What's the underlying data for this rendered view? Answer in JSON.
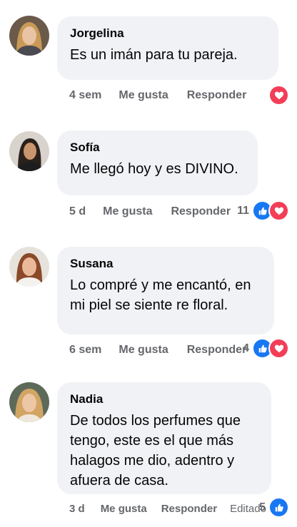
{
  "comments": [
    {
      "name": "Jorgelina",
      "text": "Es un imán para tu pareja.",
      "time": "4 sem",
      "like_label": "Me gusta",
      "reply_label": "Responder",
      "reaction_count": "",
      "reactions": [
        "heart-icon"
      ]
    },
    {
      "name": "Sofía",
      "text": "Me llegó hoy y es DIVINO.",
      "time": "5 d",
      "like_label": "Me gusta",
      "reply_label": "Responder",
      "reaction_count": "11",
      "reactions": [
        "like-icon",
        "heart-icon"
      ]
    },
    {
      "name": "Susana",
      "text": "Lo compré y me encantó, en mi piel se siente re floral.",
      "time": "6 sem",
      "like_label": "Me gusta",
      "reply_label": "Responder",
      "reaction_count": "4",
      "reactions": [
        "like-icon",
        "heart-icon"
      ]
    },
    {
      "name": "Nadia",
      "text": "De todos los perfumes que tengo, este es el que más halagos me dio, adentro y afuera de casa.",
      "time": "3 d",
      "like_label": "Me gusta",
      "reply_label": "Responder",
      "edited_label": "Editado",
      "reaction_count": "5",
      "reactions": [
        "like-icon"
      ]
    }
  ],
  "colors": {
    "bubble": "#f0f2f5",
    "meta_text": "#65676b",
    "heart": "#f33e58",
    "like": "#1877f2"
  }
}
